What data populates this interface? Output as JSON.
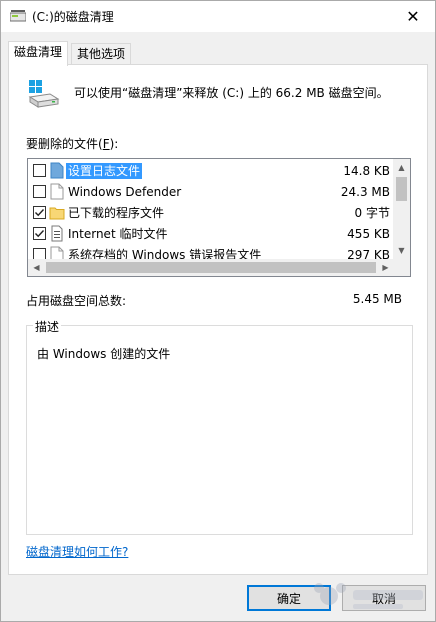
{
  "window": {
    "title": "(C:)的磁盘清理",
    "close_glyph": "✕"
  },
  "tabs": [
    {
      "label": "磁盘清理",
      "active": true
    },
    {
      "label": "其他选项",
      "active": false
    }
  ],
  "intro": "可以使用“磁盘清理”来释放 (C:) 上的 66.2 MB 磁盘空间。",
  "files_label_prefix": "要删除的文件(",
  "files_label_key": "F",
  "files_label_suffix": "):",
  "files": [
    {
      "name": "设置日志文件",
      "size": "14.8 KB",
      "checked": false,
      "selected": true,
      "icon": "file-icon"
    },
    {
      "name": "Windows Defender",
      "size": "24.3 MB",
      "checked": false,
      "selected": false,
      "icon": "file-icon"
    },
    {
      "name": "已下载的程序文件",
      "size": "0 字节",
      "checked": true,
      "selected": false,
      "icon": "folder-icon"
    },
    {
      "name": "Internet 临时文件",
      "size": "455 KB",
      "checked": true,
      "selected": false,
      "icon": "document-icon"
    },
    {
      "name": "系统存档的 Windows 错误报告文件",
      "size": "297 KB",
      "checked": false,
      "selected": false,
      "icon": "file-icon"
    }
  ],
  "total_label": "占用磁盘空间总数:",
  "total_value": "5.45 MB",
  "description": {
    "legend": "描述",
    "text": "由 Windows 创建的文件"
  },
  "help_link": "磁盘清理如何工作?",
  "buttons": {
    "ok": "确定",
    "cancel": "取消"
  },
  "colors": {
    "selection": "#3399ff",
    "link": "#0066cc",
    "default_button_border": "#0078d7"
  }
}
